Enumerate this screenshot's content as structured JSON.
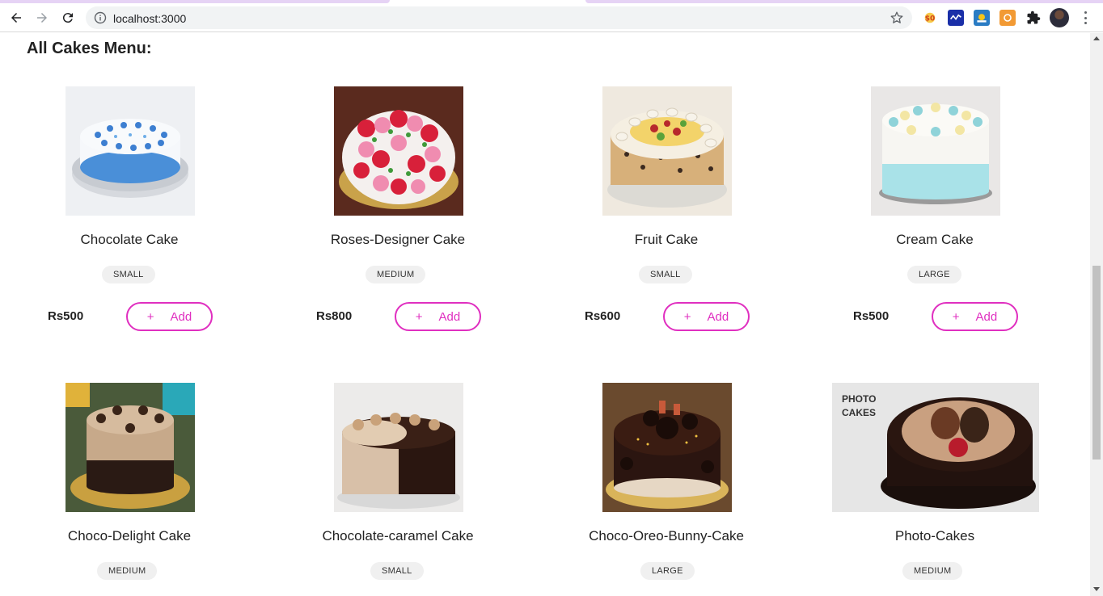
{
  "browser": {
    "url": "localhost:3000",
    "extensions": [
      "extension-1-icon",
      "extension-2-icon",
      "extension-3-icon",
      "extension-4-icon",
      "extensions-puzzle-icon"
    ],
    "accent": "#e6d3f5"
  },
  "page": {
    "title": "All Cakes Menu:",
    "accent_color": "#e02fc0"
  },
  "products": [
    {
      "name": "Chocolate Cake",
      "size": "SMALL",
      "price": "Rs500",
      "add_label": "Add",
      "plus": "+"
    },
    {
      "name": "Roses-Designer Cake",
      "size": "MEDIUM",
      "price": "Rs800",
      "add_label": "Add",
      "plus": "+"
    },
    {
      "name": "Fruit Cake",
      "size": "SMALL",
      "price": "Rs600",
      "add_label": "Add",
      "plus": "+"
    },
    {
      "name": "Cream Cake",
      "size": "LARGE",
      "price": "Rs500",
      "add_label": "Add",
      "plus": "+"
    },
    {
      "name": "Choco-Delight Cake",
      "size": "MEDIUM"
    },
    {
      "name": "Chocolate-caramel Cake",
      "size": "SMALL"
    },
    {
      "name": "Choco-Oreo-Bunny-Cake",
      "size": "LARGE"
    },
    {
      "name": "Photo-Cakes",
      "size": "MEDIUM",
      "image_text": "PHOTO CAKES"
    }
  ]
}
